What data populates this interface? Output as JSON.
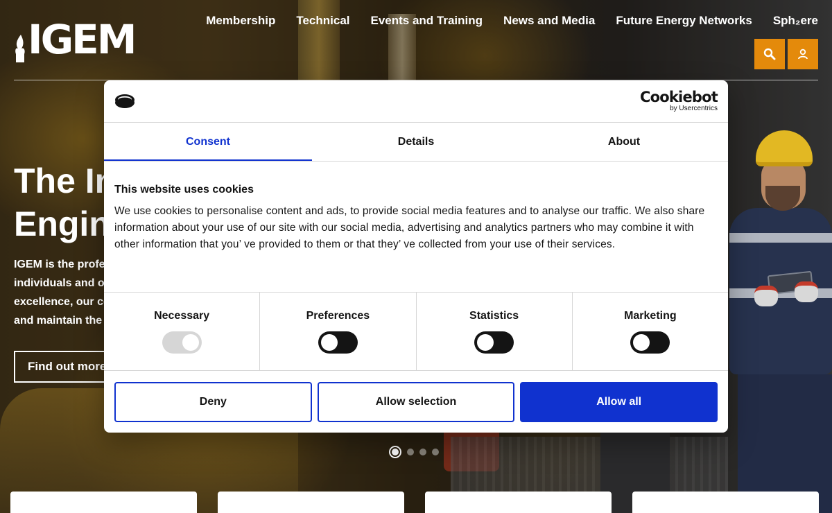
{
  "header": {
    "logo_text": "IGEM",
    "nav": [
      {
        "label": "Membership"
      },
      {
        "label": "Technical"
      },
      {
        "label": "Events and Training"
      },
      {
        "label": "News and Media"
      },
      {
        "label": "Future Energy Networks"
      },
      {
        "label": "Sph₂ere"
      }
    ],
    "search_icon": "search-icon",
    "user_icon": "user-icon"
  },
  "hero": {
    "title_line1": "The In",
    "title_line2": "Engin",
    "text_lines": [
      "IGEM is the profe",
      "individuals and o",
      "excellence, our co",
      "and maintain the"
    ],
    "cta_label": "Find out more",
    "slides": 4,
    "active_slide": 1
  },
  "cookie": {
    "brand_name": "Cookiebot",
    "brand_by": "by Usercentrics",
    "tabs": [
      {
        "label": "Consent",
        "active": true
      },
      {
        "label": "Details",
        "active": false
      },
      {
        "label": "About",
        "active": false
      }
    ],
    "title": "This website uses cookies",
    "text": "We use cookies to personalise content and ads, to provide social media features and to analyse our traffic. We also share information about your use of our site with our social media, advertising and analytics partners who may combine it with other information that you’ ve provided to them or that they’ ve collected from your use of their services.",
    "categories": [
      {
        "label": "Necessary",
        "state": "on-disabled"
      },
      {
        "label": "Preferences",
        "state": "off"
      },
      {
        "label": "Statistics",
        "state": "off"
      },
      {
        "label": "Marketing",
        "state": "off"
      }
    ],
    "buttons": {
      "deny": "Deny",
      "allow_selection": "Allow selection",
      "allow_all": "Allow all"
    }
  },
  "colors": {
    "accent_orange": "#e48a0b",
    "cookiebot_blue": "#1032cf"
  }
}
